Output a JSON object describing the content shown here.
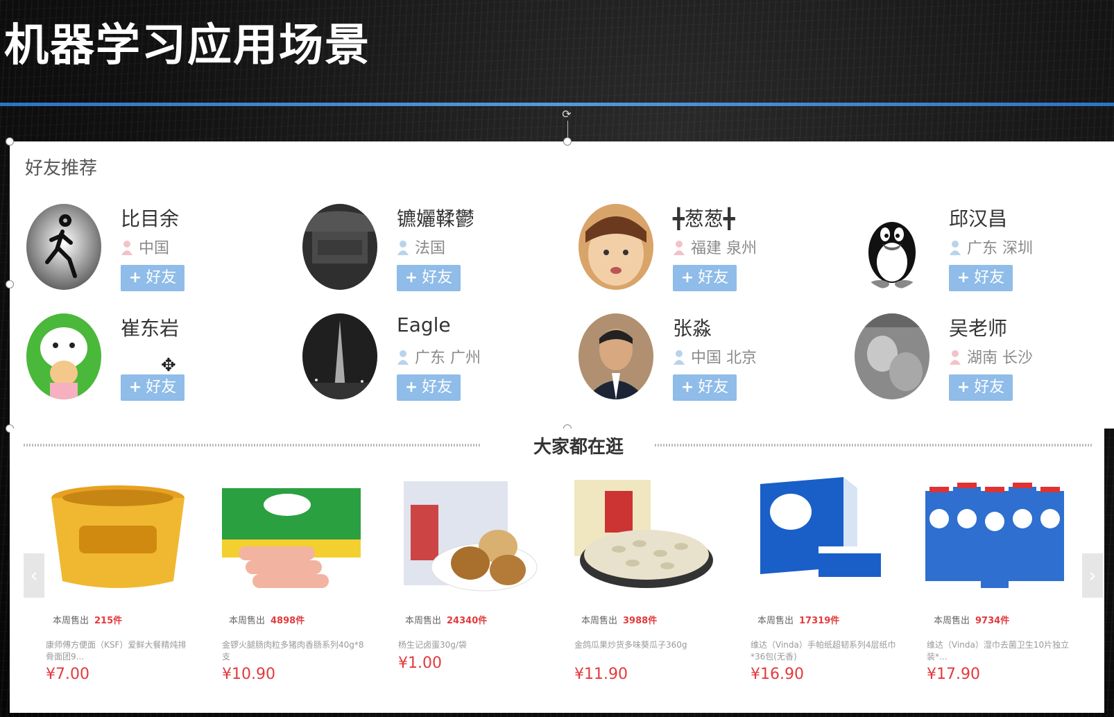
{
  "slide": {
    "title": "机器学习应用场景"
  },
  "friends": {
    "heading": "好友推荐",
    "add_label": "好友",
    "items": [
      {
        "name": "比目余",
        "location": "中国",
        "gender": "female"
      },
      {
        "name": "镳孋鞣鬱",
        "location": "法国",
        "gender": "male"
      },
      {
        "name": "╋葱葱╋",
        "location": "福建 泉州",
        "gender": "female"
      },
      {
        "name": "邱汉昌",
        "location": "广东 深圳",
        "gender": "male"
      },
      {
        "name": "崔东岩",
        "location": "",
        "gender": ""
      },
      {
        "name": "Eagle",
        "location": "广东 广州",
        "gender": "male"
      },
      {
        "name": "张淼",
        "location": "中国 北京",
        "gender": "male"
      },
      {
        "name": "吴老师",
        "location": "湖南 长沙",
        "gender": "female"
      }
    ]
  },
  "products": {
    "heading": "大家都在逛",
    "sold_label": "本周售出",
    "items": [
      {
        "sold": "215件",
        "name": "康师傅方便面（KSF）爱鲜大餐精炖排骨面团9...",
        "price": "¥7.00",
        "icon": "instant-noodle-bowl"
      },
      {
        "sold": "4898件",
        "name": "金锣火腿肠肉粒多猪肉香肠系列40g*8支",
        "price": "¥10.90",
        "icon": "sausage-pack"
      },
      {
        "sold": "24340件",
        "name": "杨生记卤蛋30g/袋",
        "price": "¥1.00",
        "icon": "braised-egg"
      },
      {
        "sold": "3988件",
        "name": "金鸽瓜果炒货多味葵瓜子360g",
        "price": "¥11.90",
        "icon": "sunflower-seeds"
      },
      {
        "sold": "17319件",
        "name": "维达（Vinda）手帕纸超韧系列4层纸巾*36包(无香)",
        "price": "¥16.90",
        "icon": "tissue-box"
      },
      {
        "sold": "9734件",
        "name": "维达（Vinda）湿巾去菌卫生10片独立装*...",
        "price": "¥17.90",
        "icon": "wet-wipes"
      }
    ]
  },
  "colors": {
    "accent_blue": "#2f7fd8",
    "button_blue": "#8fbce8",
    "price_red": "#e4393c"
  }
}
